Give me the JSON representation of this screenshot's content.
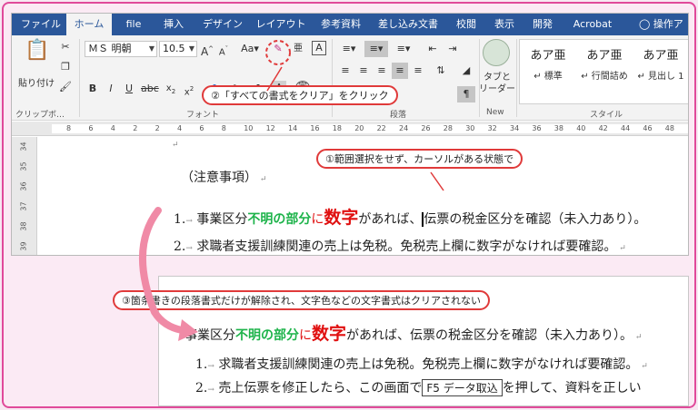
{
  "tabs": [
    "ファイル",
    "ホーム",
    "file",
    "挿入",
    "デザイン",
    "レイアウト",
    "参考資料",
    "差し込み文書",
    "校閲",
    "表示",
    "開発",
    "Acrobat",
    "操作ア"
  ],
  "ribbon": {
    "paste_label": "貼り付け",
    "clipboard_label": "クリップボ…",
    "font_name": "ＭＳ 明朝",
    "font_size": "10.5",
    "font_group_label": "フォント",
    "paragraph_group_label": "段落",
    "tabs_leader_label": "タブと\nリーダー",
    "new_group_label": "New",
    "styles_group_label": "スタイル",
    "styles": [
      {
        "preview": "あア亜",
        "name": "標準"
      },
      {
        "preview": "あア亜",
        "name": "行間詰め"
      },
      {
        "preview": "あア亜",
        "name": "見出し 1"
      }
    ]
  },
  "ruler": {
    "marks": [
      "8",
      "6",
      "4",
      "2",
      "2",
      "4",
      "6",
      "8",
      "10",
      "12",
      "14",
      "16",
      "18",
      "20",
      "22",
      "24",
      "26",
      "28",
      "30",
      "32",
      "34",
      "36",
      "38",
      "40",
      "42",
      "44",
      "46",
      "48"
    ]
  },
  "vruler": [
    "34",
    "35",
    "36",
    "37",
    "38",
    "39"
  ],
  "document": {
    "heading": "（注意事項）",
    "item1_num": "1.",
    "item1_a": "事業区分",
    "item1_green": "不明の部分",
    "item1_red": "に",
    "item1_big": "数字",
    "item1_b": "があれば、",
    "item1_c": "伝票の税金区分を確認（未入力あり）。",
    "item2_num": "2.",
    "item2": "求職者支援訓練関連の売上は免税。免税売上欄に数字がなければ要確認。"
  },
  "callouts": {
    "step1": "①範囲選択をせず、カーソルがある状態で",
    "step2": "②「すべての書式をクリア」をクリック",
    "step3": "③箇条書きの段落書式だけが解除され、文字色などの文字書式はクリアされない"
  },
  "result": {
    "line1_a": "事業区分",
    "line1_green": "不明の部分",
    "line1_red": "に",
    "line1_big": "数字",
    "line1_b": "があれば、伝票の税金区分を確認（未入力あり）。",
    "line2_num": "1.",
    "line2": "求職者支援訓練関連の売上は免税。免税売上欄に数字がなければ要確認。",
    "line3_num": "2.",
    "line3_a": "売上伝票を修正したら、この画面で",
    "line3_key": "F5 データ取込",
    "line3_b": "を押して、資料を正しい"
  },
  "colors": {
    "accent": "#2b579a",
    "callout_border": "#e03a3a",
    "frame": "#e04a9a",
    "green_text": "#1db34a",
    "red_text": "#e01010"
  }
}
